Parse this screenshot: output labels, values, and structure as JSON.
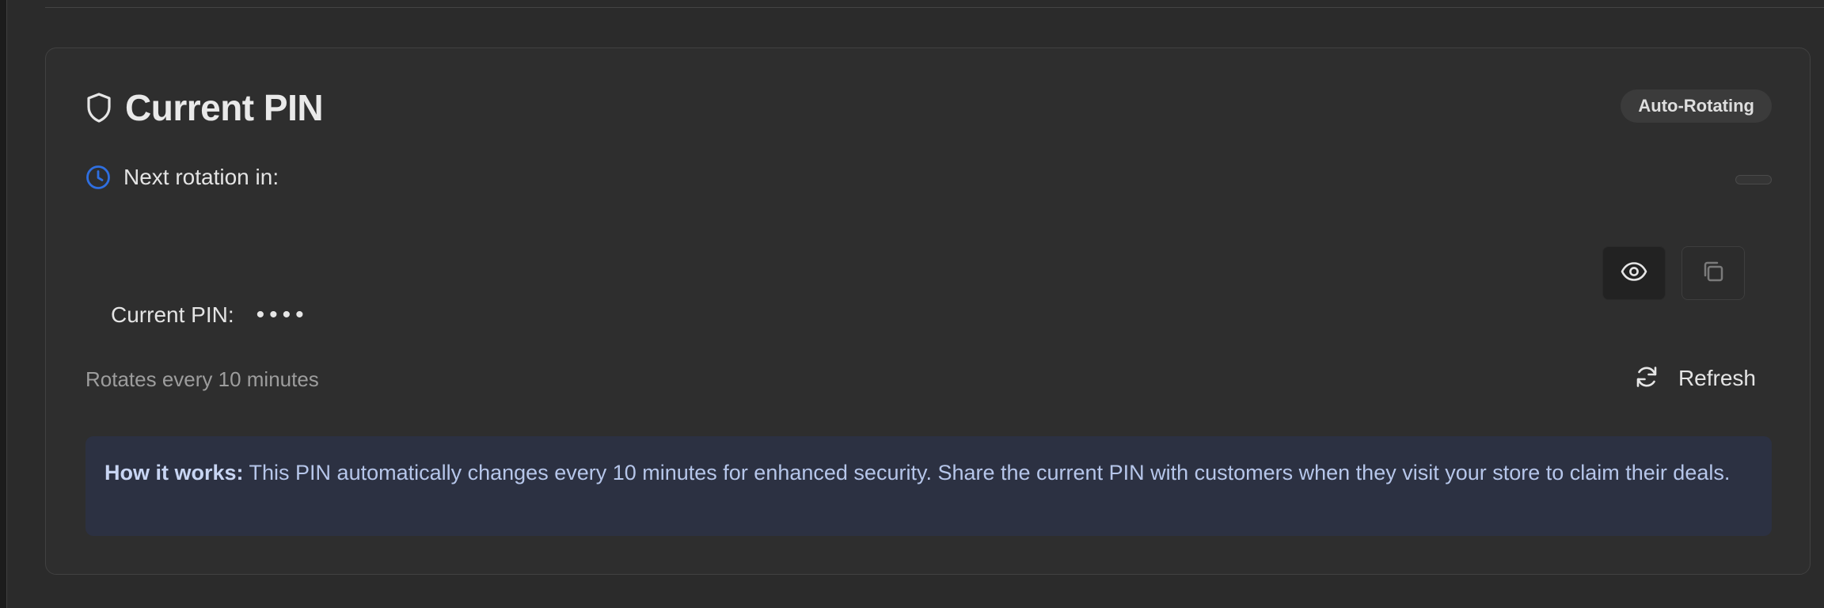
{
  "card": {
    "title": "Current PIN",
    "badge": "Auto-Rotating",
    "rotation_label": "Next rotation in:",
    "countdown": "",
    "pin_label": "Current PIN:",
    "pin_masked": "••••",
    "rotate_note": "Rotates every 10 minutes",
    "refresh_label": "Refresh"
  },
  "info": {
    "lead": "How it works:",
    "text": " This PIN automatically changes every 10 minutes for enhanced security. Share the current PIN with customers when they visit your store to claim their deals."
  },
  "icons": {
    "title_icon": "shield-icon",
    "rotation_icon": "clock-icon",
    "reveal_icon": "eye-icon",
    "copy_icon": "copy-icon",
    "refresh_icon": "refresh-icon"
  },
  "colors": {
    "accent_blue": "#2f6fe0",
    "info_bg": "#2c3142",
    "info_text": "#b6c6ea",
    "card_bg": "#2e2e2e"
  }
}
